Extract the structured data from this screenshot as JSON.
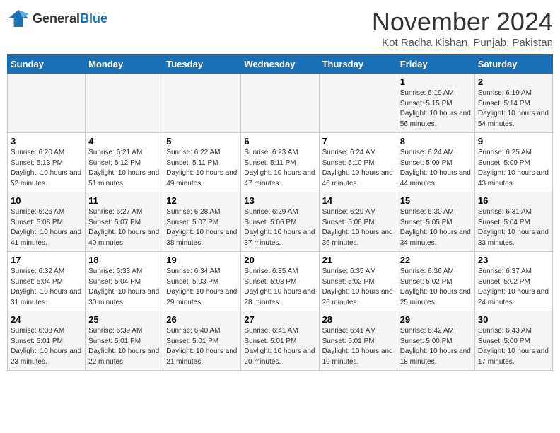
{
  "logo": {
    "text_general": "General",
    "text_blue": "Blue"
  },
  "calendar": {
    "title": "November 2024",
    "subtitle": "Kot Radha Kishan, Punjab, Pakistan"
  },
  "weekdays": [
    "Sunday",
    "Monday",
    "Tuesday",
    "Wednesday",
    "Thursday",
    "Friday",
    "Saturday"
  ],
  "weeks": [
    [
      {
        "day": "",
        "info": ""
      },
      {
        "day": "",
        "info": ""
      },
      {
        "day": "",
        "info": ""
      },
      {
        "day": "",
        "info": ""
      },
      {
        "day": "",
        "info": ""
      },
      {
        "day": "1",
        "info": "Sunrise: 6:19 AM\nSunset: 5:15 PM\nDaylight: 10 hours and 56 minutes."
      },
      {
        "day": "2",
        "info": "Sunrise: 6:19 AM\nSunset: 5:14 PM\nDaylight: 10 hours and 54 minutes."
      }
    ],
    [
      {
        "day": "3",
        "info": "Sunrise: 6:20 AM\nSunset: 5:13 PM\nDaylight: 10 hours and 52 minutes."
      },
      {
        "day": "4",
        "info": "Sunrise: 6:21 AM\nSunset: 5:12 PM\nDaylight: 10 hours and 51 minutes."
      },
      {
        "day": "5",
        "info": "Sunrise: 6:22 AM\nSunset: 5:11 PM\nDaylight: 10 hours and 49 minutes."
      },
      {
        "day": "6",
        "info": "Sunrise: 6:23 AM\nSunset: 5:11 PM\nDaylight: 10 hours and 47 minutes."
      },
      {
        "day": "7",
        "info": "Sunrise: 6:24 AM\nSunset: 5:10 PM\nDaylight: 10 hours and 46 minutes."
      },
      {
        "day": "8",
        "info": "Sunrise: 6:24 AM\nSunset: 5:09 PM\nDaylight: 10 hours and 44 minutes."
      },
      {
        "day": "9",
        "info": "Sunrise: 6:25 AM\nSunset: 5:09 PM\nDaylight: 10 hours and 43 minutes."
      }
    ],
    [
      {
        "day": "10",
        "info": "Sunrise: 6:26 AM\nSunset: 5:08 PM\nDaylight: 10 hours and 41 minutes."
      },
      {
        "day": "11",
        "info": "Sunrise: 6:27 AM\nSunset: 5:07 PM\nDaylight: 10 hours and 40 minutes."
      },
      {
        "day": "12",
        "info": "Sunrise: 6:28 AM\nSunset: 5:07 PM\nDaylight: 10 hours and 38 minutes."
      },
      {
        "day": "13",
        "info": "Sunrise: 6:29 AM\nSunset: 5:06 PM\nDaylight: 10 hours and 37 minutes."
      },
      {
        "day": "14",
        "info": "Sunrise: 6:29 AM\nSunset: 5:06 PM\nDaylight: 10 hours and 36 minutes."
      },
      {
        "day": "15",
        "info": "Sunrise: 6:30 AM\nSunset: 5:05 PM\nDaylight: 10 hours and 34 minutes."
      },
      {
        "day": "16",
        "info": "Sunrise: 6:31 AM\nSunset: 5:04 PM\nDaylight: 10 hours and 33 minutes."
      }
    ],
    [
      {
        "day": "17",
        "info": "Sunrise: 6:32 AM\nSunset: 5:04 PM\nDaylight: 10 hours and 31 minutes."
      },
      {
        "day": "18",
        "info": "Sunrise: 6:33 AM\nSunset: 5:04 PM\nDaylight: 10 hours and 30 minutes."
      },
      {
        "day": "19",
        "info": "Sunrise: 6:34 AM\nSunset: 5:03 PM\nDaylight: 10 hours and 29 minutes."
      },
      {
        "day": "20",
        "info": "Sunrise: 6:35 AM\nSunset: 5:03 PM\nDaylight: 10 hours and 28 minutes."
      },
      {
        "day": "21",
        "info": "Sunrise: 6:35 AM\nSunset: 5:02 PM\nDaylight: 10 hours and 26 minutes."
      },
      {
        "day": "22",
        "info": "Sunrise: 6:36 AM\nSunset: 5:02 PM\nDaylight: 10 hours and 25 minutes."
      },
      {
        "day": "23",
        "info": "Sunrise: 6:37 AM\nSunset: 5:02 PM\nDaylight: 10 hours and 24 minutes."
      }
    ],
    [
      {
        "day": "24",
        "info": "Sunrise: 6:38 AM\nSunset: 5:01 PM\nDaylight: 10 hours and 23 minutes."
      },
      {
        "day": "25",
        "info": "Sunrise: 6:39 AM\nSunset: 5:01 PM\nDaylight: 10 hours and 22 minutes."
      },
      {
        "day": "26",
        "info": "Sunrise: 6:40 AM\nSunset: 5:01 PM\nDaylight: 10 hours and 21 minutes."
      },
      {
        "day": "27",
        "info": "Sunrise: 6:41 AM\nSunset: 5:01 PM\nDaylight: 10 hours and 20 minutes."
      },
      {
        "day": "28",
        "info": "Sunrise: 6:41 AM\nSunset: 5:01 PM\nDaylight: 10 hours and 19 minutes."
      },
      {
        "day": "29",
        "info": "Sunrise: 6:42 AM\nSunset: 5:00 PM\nDaylight: 10 hours and 18 minutes."
      },
      {
        "day": "30",
        "info": "Sunrise: 6:43 AM\nSunset: 5:00 PM\nDaylight: 10 hours and 17 minutes."
      }
    ]
  ]
}
